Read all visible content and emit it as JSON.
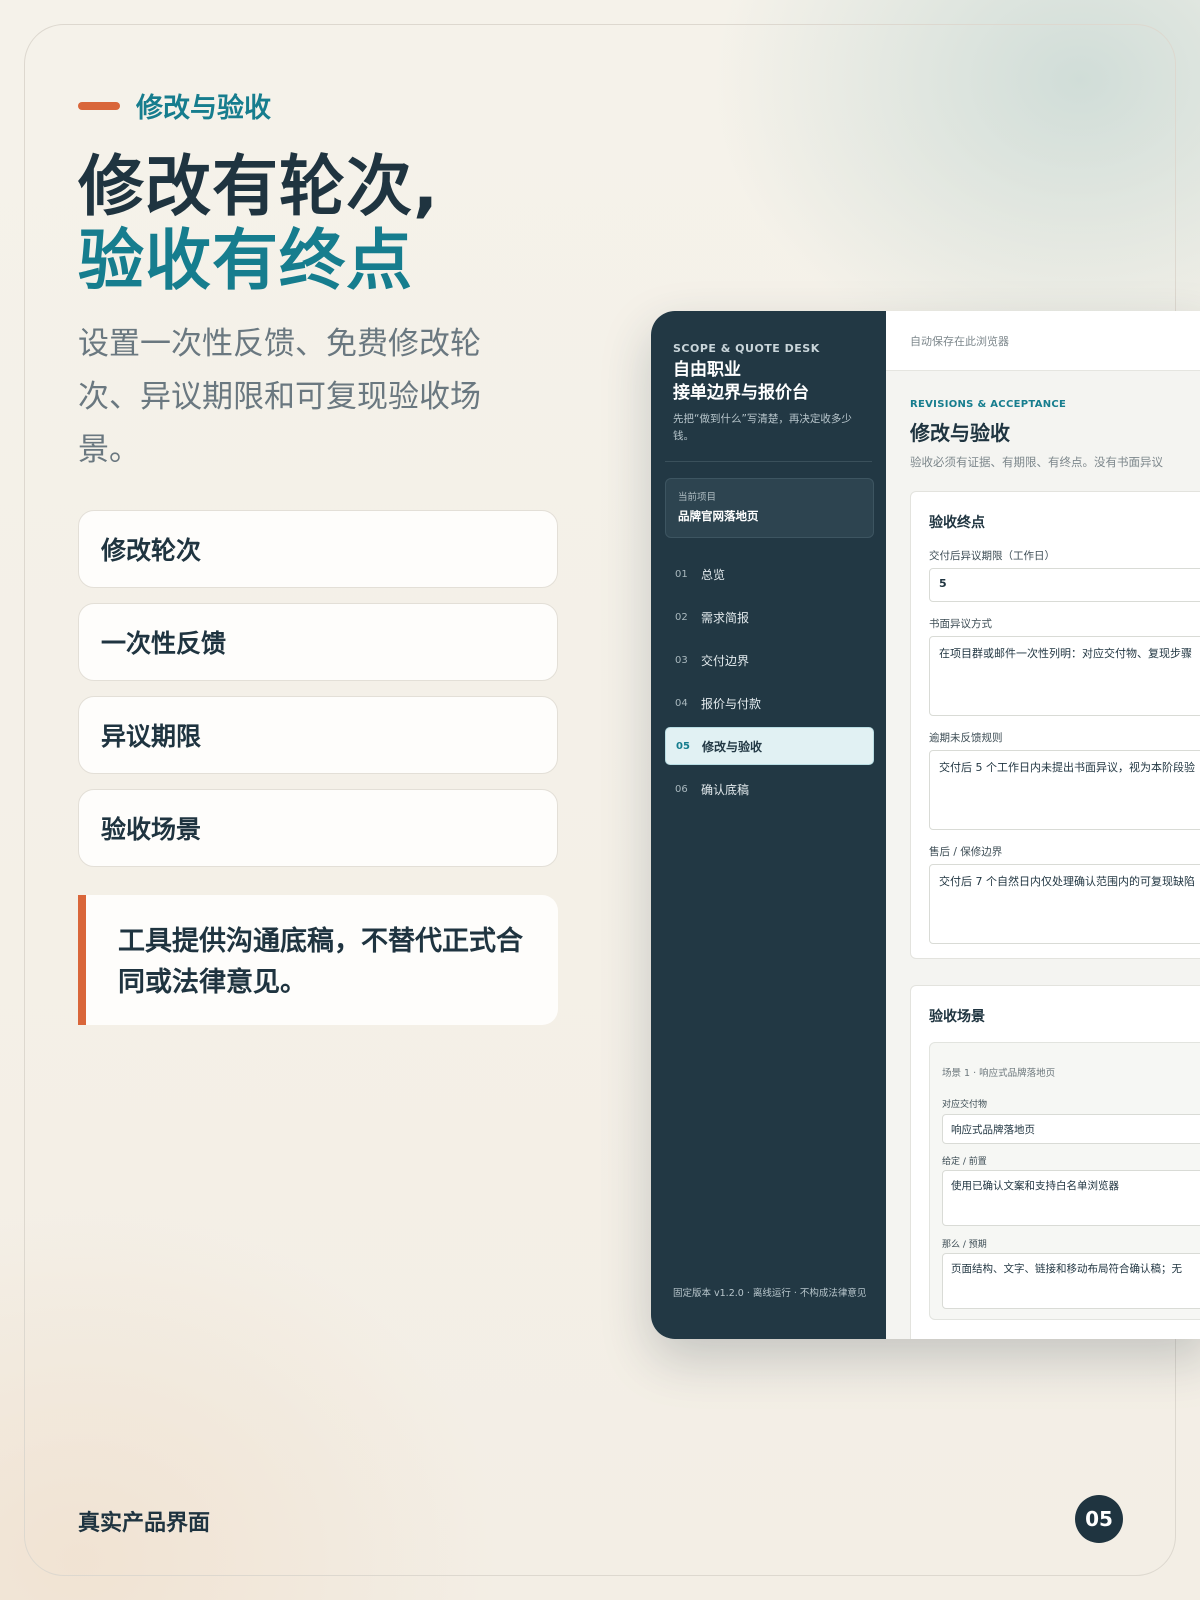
{
  "slide": {
    "eyebrow": "修改与验收",
    "headline_line1": "修改有轮次,",
    "headline_line2": "验收有终点",
    "subcopy": "设置一次性反馈、免费修改轮次、异议期限和可复现验收场景。",
    "features": [
      "修改轮次",
      "一次性反馈",
      "异议期限",
      "验收场景"
    ],
    "note": "工具提供沟通底稿，不替代正式合同或法律意见。",
    "footer_label": "真实产品界面",
    "page_number": "05",
    "colors": {
      "accent_orange": "#d9663a",
      "accent_teal": "#167d8e",
      "navy": "#1f3440"
    }
  },
  "app": {
    "sidebar": {
      "kicker": "SCOPE & QUOTE DESK",
      "title_line1": "自由职业",
      "title_line2": "接单边界与报价台",
      "subtitle": "先把“做到什么”写清楚，再决定收多少钱。",
      "project_label": "当前项目",
      "project_name": "品牌官网落地页",
      "nav": [
        {
          "num": "01",
          "label": "总览"
        },
        {
          "num": "02",
          "label": "需求简报"
        },
        {
          "num": "03",
          "label": "交付边界"
        },
        {
          "num": "04",
          "label": "报价与付款"
        },
        {
          "num": "05",
          "label": "修改与验收",
          "active": true
        },
        {
          "num": "06",
          "label": "确认底稿"
        }
      ],
      "footer": "固定版本 v1.2.0 · 离线运行 · 不构成法律意见"
    },
    "topbar": {
      "status": "自动保存在此浏览器"
    },
    "main": {
      "kicker": "REVISIONS & ACCEPTANCE",
      "title": "修改与验收",
      "description": "验收必须有证据、有期限、有终点。没有书面异议",
      "endpoint_panel": {
        "title": "验收终点",
        "objection_days_label": "交付后异议期限（工作日）",
        "objection_days_value": "5",
        "objection_method_label": "书面异议方式",
        "objection_method_value": "在项目群或邮件一次性列明：对应交付物、复现步骤",
        "no_feedback_label": "逾期未反馈规则",
        "no_feedback_value": "交付后 5 个工作日内未提出书面异议，视为本阶段验",
        "warranty_label": "售后 / 保修边界",
        "warranty_value": "交付后 7 个自然日内仅处理确认范围内的可复现缺陷"
      },
      "scenario_panel": {
        "title": "验收场景",
        "scene_title": "场景 1 · 响应式品牌落地页",
        "deliverable_label": "对应交付物",
        "deliverable_value": "响应式品牌落地页",
        "given_label": "给定 / 前置",
        "given_value": "使用已确认文案和支持白名单浏览器",
        "then_label": "那么 / 预期",
        "then_value": "页面结构、文字、链接和移动布局符合确认稿；无"
      }
    }
  }
}
